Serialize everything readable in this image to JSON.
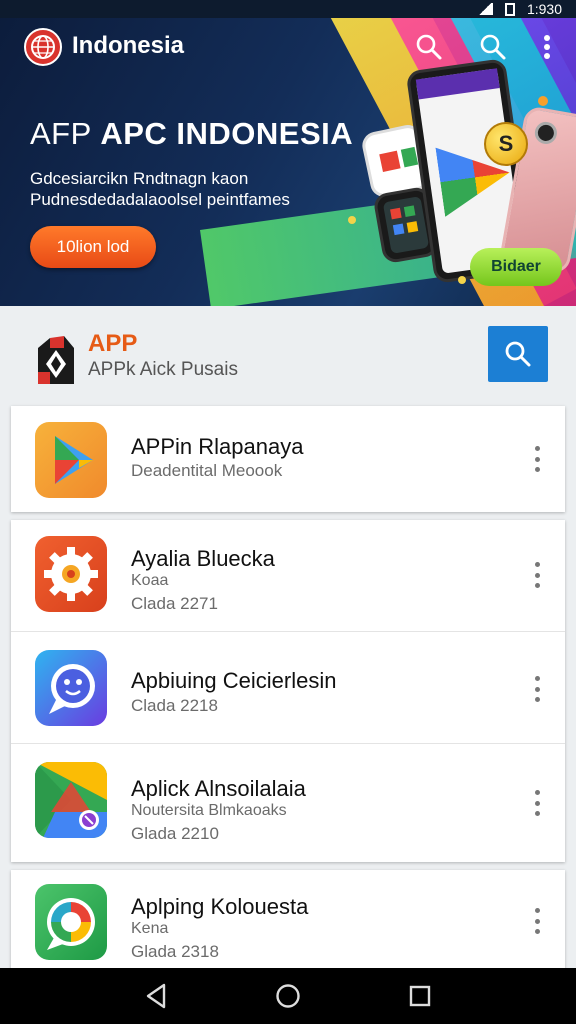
{
  "status_bar": {
    "time": "1:930"
  },
  "hero": {
    "brand": "Indonesia",
    "title_light": "AFP",
    "title_bold": "APC INDONESIA",
    "subtitle": "Gdcesiarcikn Rndtnagn kaon Pudnesdedadalaoolsel peintfames",
    "cta_label": "10lion lod",
    "badge_label": "Bidaer",
    "coin_glyph": "S"
  },
  "header": {
    "title": "APP",
    "subtitle": "APPk Aick Pusais"
  },
  "apps": [
    {
      "name": "APPin Rlapanaya",
      "lines": [
        "Deadentital Meoook"
      ]
    },
    {
      "name": "Ayalia Bluecka",
      "lines": [
        "Koaa",
        "Clada 2271"
      ]
    },
    {
      "name": "Apbiuing Ceicierlesin",
      "lines": [
        "Clada 2218"
      ]
    },
    {
      "name": "Aplick Alnsoilalaia",
      "lines": [
        "Noutersita Blmkaoaks",
        "Glada 2210"
      ]
    },
    {
      "name": "Aplping Kolouesta",
      "lines": [
        "Kena",
        "Glada 2318"
      ]
    }
  ],
  "icons": {
    "hero_logo": "globe-icon",
    "search1": "search-icon",
    "search2": "search-icon",
    "menu": "more-vert-icon",
    "nav": [
      "back-icon",
      "home-icon",
      "recents-icon"
    ]
  },
  "colors": {
    "accent": "#1c7fd4",
    "cta": "#e84a16",
    "header_title": "#e65b16"
  }
}
